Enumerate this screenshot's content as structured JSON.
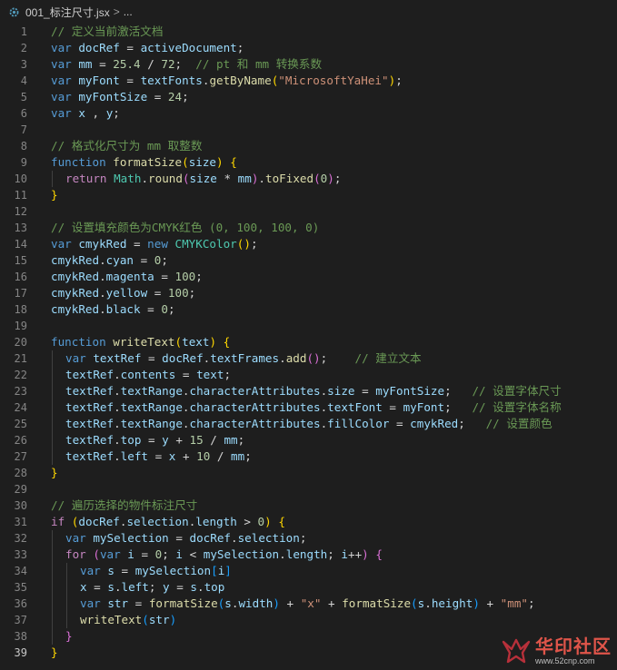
{
  "breadcrumb": {
    "file": "001_标注尺寸.jsx",
    "separator": ">",
    "trail": "..."
  },
  "colors": {
    "keyword": "#569cd6",
    "control": "#c586c0",
    "variable": "#9cdcfe",
    "function": "#dcdcaa",
    "number": "#b5cea8",
    "string": "#ce9178",
    "comment": "#6a9955",
    "class": "#4ec9b0"
  },
  "lines": [
    {
      "n": "1",
      "indent": 0,
      "tokens": [
        [
          "com",
          "// 定义当前激活文档"
        ]
      ]
    },
    {
      "n": "2",
      "indent": 0,
      "tokens": [
        [
          "kw",
          "var"
        ],
        [
          "op",
          " "
        ],
        [
          "var",
          "docRef"
        ],
        [
          "op",
          " = "
        ],
        [
          "var",
          "activeDocument"
        ],
        [
          "op",
          ";"
        ]
      ]
    },
    {
      "n": "3",
      "indent": 0,
      "tokens": [
        [
          "kw",
          "var"
        ],
        [
          "op",
          " "
        ],
        [
          "var",
          "mm"
        ],
        [
          "op",
          " = "
        ],
        [
          "num",
          "25.4"
        ],
        [
          "op",
          " / "
        ],
        [
          "num",
          "72"
        ],
        [
          "op",
          ";  "
        ],
        [
          "com",
          "// pt 和 mm 转换系数"
        ]
      ]
    },
    {
      "n": "4",
      "indent": 0,
      "tokens": [
        [
          "kw",
          "var"
        ],
        [
          "op",
          " "
        ],
        [
          "var",
          "myFont"
        ],
        [
          "op",
          " = "
        ],
        [
          "var",
          "textFonts"
        ],
        [
          "op",
          "."
        ],
        [
          "fn",
          "getByName"
        ],
        [
          "brk1",
          "("
        ],
        [
          "str",
          "\"MicrosoftYaHei\""
        ],
        [
          "brk1",
          ")"
        ],
        [
          "op",
          ";"
        ]
      ]
    },
    {
      "n": "5",
      "indent": 0,
      "tokens": [
        [
          "kw",
          "var"
        ],
        [
          "op",
          " "
        ],
        [
          "var",
          "myFontSize"
        ],
        [
          "op",
          " = "
        ],
        [
          "num",
          "24"
        ],
        [
          "op",
          ";"
        ]
      ]
    },
    {
      "n": "6",
      "indent": 0,
      "tokens": [
        [
          "kw",
          "var"
        ],
        [
          "op",
          " "
        ],
        [
          "var",
          "x"
        ],
        [
          "op",
          " , "
        ],
        [
          "var",
          "y"
        ],
        [
          "op",
          ";"
        ]
      ]
    },
    {
      "n": "7",
      "indent": 0,
      "tokens": []
    },
    {
      "n": "8",
      "indent": 0,
      "tokens": [
        [
          "com",
          "// 格式化尺寸为 mm 取整数"
        ]
      ]
    },
    {
      "n": "9",
      "indent": 0,
      "tokens": [
        [
          "kw",
          "function"
        ],
        [
          "op",
          " "
        ],
        [
          "fn",
          "formatSize"
        ],
        [
          "brk1",
          "("
        ],
        [
          "var",
          "size"
        ],
        [
          "brk1",
          ")"
        ],
        [
          "op",
          " "
        ],
        [
          "brk1",
          "{"
        ]
      ]
    },
    {
      "n": "10",
      "indent": 1,
      "tokens": [
        [
          "ctrl",
          "return"
        ],
        [
          "op",
          " "
        ],
        [
          "cls",
          "Math"
        ],
        [
          "op",
          "."
        ],
        [
          "fn",
          "round"
        ],
        [
          "brk2",
          "("
        ],
        [
          "var",
          "size"
        ],
        [
          "op",
          " * "
        ],
        [
          "var",
          "mm"
        ],
        [
          "brk2",
          ")"
        ],
        [
          "op",
          "."
        ],
        [
          "fn",
          "toFixed"
        ],
        [
          "brk2",
          "("
        ],
        [
          "num",
          "0"
        ],
        [
          "brk2",
          ")"
        ],
        [
          "op",
          ";"
        ]
      ]
    },
    {
      "n": "11",
      "indent": 0,
      "tokens": [
        [
          "brk1",
          "}"
        ]
      ]
    },
    {
      "n": "12",
      "indent": 0,
      "tokens": []
    },
    {
      "n": "13",
      "indent": 0,
      "tokens": [
        [
          "com",
          "// 设置填充颜色为CMYK红色 (0, 100, 100, 0)"
        ]
      ]
    },
    {
      "n": "14",
      "indent": 0,
      "tokens": [
        [
          "kw",
          "var"
        ],
        [
          "op",
          " "
        ],
        [
          "var",
          "cmykRed"
        ],
        [
          "op",
          " = "
        ],
        [
          "kw",
          "new"
        ],
        [
          "op",
          " "
        ],
        [
          "cls",
          "CMYKColor"
        ],
        [
          "brk1",
          "()"
        ],
        [
          "op",
          ";"
        ]
      ]
    },
    {
      "n": "15",
      "indent": 0,
      "tokens": [
        [
          "var",
          "cmykRed"
        ],
        [
          "op",
          "."
        ],
        [
          "var",
          "cyan"
        ],
        [
          "op",
          " = "
        ],
        [
          "num",
          "0"
        ],
        [
          "op",
          ";"
        ]
      ]
    },
    {
      "n": "16",
      "indent": 0,
      "tokens": [
        [
          "var",
          "cmykRed"
        ],
        [
          "op",
          "."
        ],
        [
          "var",
          "magenta"
        ],
        [
          "op",
          " = "
        ],
        [
          "num",
          "100"
        ],
        [
          "op",
          ";"
        ]
      ]
    },
    {
      "n": "17",
      "indent": 0,
      "tokens": [
        [
          "var",
          "cmykRed"
        ],
        [
          "op",
          "."
        ],
        [
          "var",
          "yellow"
        ],
        [
          "op",
          " = "
        ],
        [
          "num",
          "100"
        ],
        [
          "op",
          ";"
        ]
      ]
    },
    {
      "n": "18",
      "indent": 0,
      "tokens": [
        [
          "var",
          "cmykRed"
        ],
        [
          "op",
          "."
        ],
        [
          "var",
          "black"
        ],
        [
          "op",
          " = "
        ],
        [
          "num",
          "0"
        ],
        [
          "op",
          ";"
        ]
      ]
    },
    {
      "n": "19",
      "indent": 0,
      "tokens": []
    },
    {
      "n": "20",
      "indent": 0,
      "tokens": [
        [
          "kw",
          "function"
        ],
        [
          "op",
          " "
        ],
        [
          "fn",
          "writeText"
        ],
        [
          "brk1",
          "("
        ],
        [
          "var",
          "text"
        ],
        [
          "brk1",
          ")"
        ],
        [
          "op",
          " "
        ],
        [
          "brk1",
          "{"
        ]
      ]
    },
    {
      "n": "21",
      "indent": 1,
      "tokens": [
        [
          "kw",
          "var"
        ],
        [
          "op",
          " "
        ],
        [
          "var",
          "textRef"
        ],
        [
          "op",
          " = "
        ],
        [
          "var",
          "docRef"
        ],
        [
          "op",
          "."
        ],
        [
          "var",
          "textFrames"
        ],
        [
          "op",
          "."
        ],
        [
          "fn",
          "add"
        ],
        [
          "brk2",
          "()"
        ],
        [
          "op",
          ";    "
        ],
        [
          "com",
          "// 建立文本"
        ]
      ]
    },
    {
      "n": "22",
      "indent": 1,
      "tokens": [
        [
          "var",
          "textRef"
        ],
        [
          "op",
          "."
        ],
        [
          "var",
          "contents"
        ],
        [
          "op",
          " = "
        ],
        [
          "var",
          "text"
        ],
        [
          "op",
          ";"
        ]
      ]
    },
    {
      "n": "23",
      "indent": 1,
      "tokens": [
        [
          "var",
          "textRef"
        ],
        [
          "op",
          "."
        ],
        [
          "var",
          "textRange"
        ],
        [
          "op",
          "."
        ],
        [
          "var",
          "characterAttributes"
        ],
        [
          "op",
          "."
        ],
        [
          "var",
          "size"
        ],
        [
          "op",
          " = "
        ],
        [
          "var",
          "myFontSize"
        ],
        [
          "op",
          ";   "
        ],
        [
          "com",
          "// 设置字体尺寸"
        ]
      ]
    },
    {
      "n": "24",
      "indent": 1,
      "tokens": [
        [
          "var",
          "textRef"
        ],
        [
          "op",
          "."
        ],
        [
          "var",
          "textRange"
        ],
        [
          "op",
          "."
        ],
        [
          "var",
          "characterAttributes"
        ],
        [
          "op",
          "."
        ],
        [
          "var",
          "textFont"
        ],
        [
          "op",
          " = "
        ],
        [
          "var",
          "myFont"
        ],
        [
          "op",
          ";   "
        ],
        [
          "com",
          "// 设置字体名称"
        ]
      ]
    },
    {
      "n": "25",
      "indent": 1,
      "tokens": [
        [
          "var",
          "textRef"
        ],
        [
          "op",
          "."
        ],
        [
          "var",
          "textRange"
        ],
        [
          "op",
          "."
        ],
        [
          "var",
          "characterAttributes"
        ],
        [
          "op",
          "."
        ],
        [
          "var",
          "fillColor"
        ],
        [
          "op",
          " = "
        ],
        [
          "var",
          "cmykRed"
        ],
        [
          "op",
          ";   "
        ],
        [
          "com",
          "// 设置颜色"
        ]
      ]
    },
    {
      "n": "26",
      "indent": 1,
      "tokens": [
        [
          "var",
          "textRef"
        ],
        [
          "op",
          "."
        ],
        [
          "var",
          "top"
        ],
        [
          "op",
          " = "
        ],
        [
          "var",
          "y"
        ],
        [
          "op",
          " + "
        ],
        [
          "num",
          "15"
        ],
        [
          "op",
          " / "
        ],
        [
          "var",
          "mm"
        ],
        [
          "op",
          ";"
        ]
      ]
    },
    {
      "n": "27",
      "indent": 1,
      "tokens": [
        [
          "var",
          "textRef"
        ],
        [
          "op",
          "."
        ],
        [
          "var",
          "left"
        ],
        [
          "op",
          " = "
        ],
        [
          "var",
          "x"
        ],
        [
          "op",
          " + "
        ],
        [
          "num",
          "10"
        ],
        [
          "op",
          " / "
        ],
        [
          "var",
          "mm"
        ],
        [
          "op",
          ";"
        ]
      ]
    },
    {
      "n": "28",
      "indent": 0,
      "tokens": [
        [
          "brk1",
          "}"
        ]
      ]
    },
    {
      "n": "29",
      "indent": 0,
      "tokens": []
    },
    {
      "n": "30",
      "indent": 0,
      "tokens": [
        [
          "com",
          "// 遍历选择的物件标注尺寸"
        ]
      ]
    },
    {
      "n": "31",
      "indent": 0,
      "tokens": [
        [
          "ctrl",
          "if"
        ],
        [
          "op",
          " "
        ],
        [
          "brk1",
          "("
        ],
        [
          "var",
          "docRef"
        ],
        [
          "op",
          "."
        ],
        [
          "var",
          "selection"
        ],
        [
          "op",
          "."
        ],
        [
          "var",
          "length"
        ],
        [
          "op",
          " > "
        ],
        [
          "num",
          "0"
        ],
        [
          "brk1",
          ")"
        ],
        [
          "op",
          " "
        ],
        [
          "brk1",
          "{"
        ]
      ]
    },
    {
      "n": "32",
      "indent": 1,
      "tokens": [
        [
          "kw",
          "var"
        ],
        [
          "op",
          " "
        ],
        [
          "var",
          "mySelection"
        ],
        [
          "op",
          " = "
        ],
        [
          "var",
          "docRef"
        ],
        [
          "op",
          "."
        ],
        [
          "var",
          "selection"
        ],
        [
          "op",
          ";"
        ]
      ]
    },
    {
      "n": "33",
      "indent": 1,
      "tokens": [
        [
          "ctrl",
          "for"
        ],
        [
          "op",
          " "
        ],
        [
          "brk2",
          "("
        ],
        [
          "kw",
          "var"
        ],
        [
          "op",
          " "
        ],
        [
          "var",
          "i"
        ],
        [
          "op",
          " = "
        ],
        [
          "num",
          "0"
        ],
        [
          "op",
          "; "
        ],
        [
          "var",
          "i"
        ],
        [
          "op",
          " < "
        ],
        [
          "var",
          "mySelection"
        ],
        [
          "op",
          "."
        ],
        [
          "var",
          "length"
        ],
        [
          "op",
          "; "
        ],
        [
          "var",
          "i"
        ],
        [
          "op",
          "++"
        ],
        [
          "brk2",
          ")"
        ],
        [
          "op",
          " "
        ],
        [
          "brk2",
          "{"
        ]
      ]
    },
    {
      "n": "34",
      "indent": 2,
      "tokens": [
        [
          "kw",
          "var"
        ],
        [
          "op",
          " "
        ],
        [
          "var",
          "s"
        ],
        [
          "op",
          " = "
        ],
        [
          "var",
          "mySelection"
        ],
        [
          "brk3",
          "["
        ],
        [
          "var",
          "i"
        ],
        [
          "brk3",
          "]"
        ]
      ]
    },
    {
      "n": "35",
      "indent": 2,
      "tokens": [
        [
          "var",
          "x"
        ],
        [
          "op",
          " = "
        ],
        [
          "var",
          "s"
        ],
        [
          "op",
          "."
        ],
        [
          "var",
          "left"
        ],
        [
          "op",
          "; "
        ],
        [
          "var",
          "y"
        ],
        [
          "op",
          " = "
        ],
        [
          "var",
          "s"
        ],
        [
          "op",
          "."
        ],
        [
          "var",
          "top"
        ]
      ]
    },
    {
      "n": "36",
      "indent": 2,
      "tokens": [
        [
          "kw",
          "var"
        ],
        [
          "op",
          " "
        ],
        [
          "var",
          "str"
        ],
        [
          "op",
          " = "
        ],
        [
          "fn",
          "formatSize"
        ],
        [
          "brk3",
          "("
        ],
        [
          "var",
          "s"
        ],
        [
          "op",
          "."
        ],
        [
          "var",
          "width"
        ],
        [
          "brk3",
          ")"
        ],
        [
          "op",
          " + "
        ],
        [
          "str",
          "\"x\""
        ],
        [
          "op",
          " + "
        ],
        [
          "fn",
          "formatSize"
        ],
        [
          "brk3",
          "("
        ],
        [
          "var",
          "s"
        ],
        [
          "op",
          "."
        ],
        [
          "var",
          "height"
        ],
        [
          "brk3",
          ")"
        ],
        [
          "op",
          " + "
        ],
        [
          "str",
          "\"mm\""
        ],
        [
          "op",
          ";"
        ]
      ]
    },
    {
      "n": "37",
      "indent": 2,
      "tokens": [
        [
          "fn",
          "writeText"
        ],
        [
          "brk3",
          "("
        ],
        [
          "var",
          "str"
        ],
        [
          "brk3",
          ")"
        ]
      ]
    },
    {
      "n": "38",
      "indent": 1,
      "tokens": [
        [
          "brk2",
          "}"
        ]
      ]
    },
    {
      "n": "39",
      "indent": 0,
      "tokens": [
        [
          "brk1",
          "}"
        ]
      ]
    }
  ],
  "watermark": {
    "brand": "华印社区",
    "url": "www.52cnp.com"
  }
}
